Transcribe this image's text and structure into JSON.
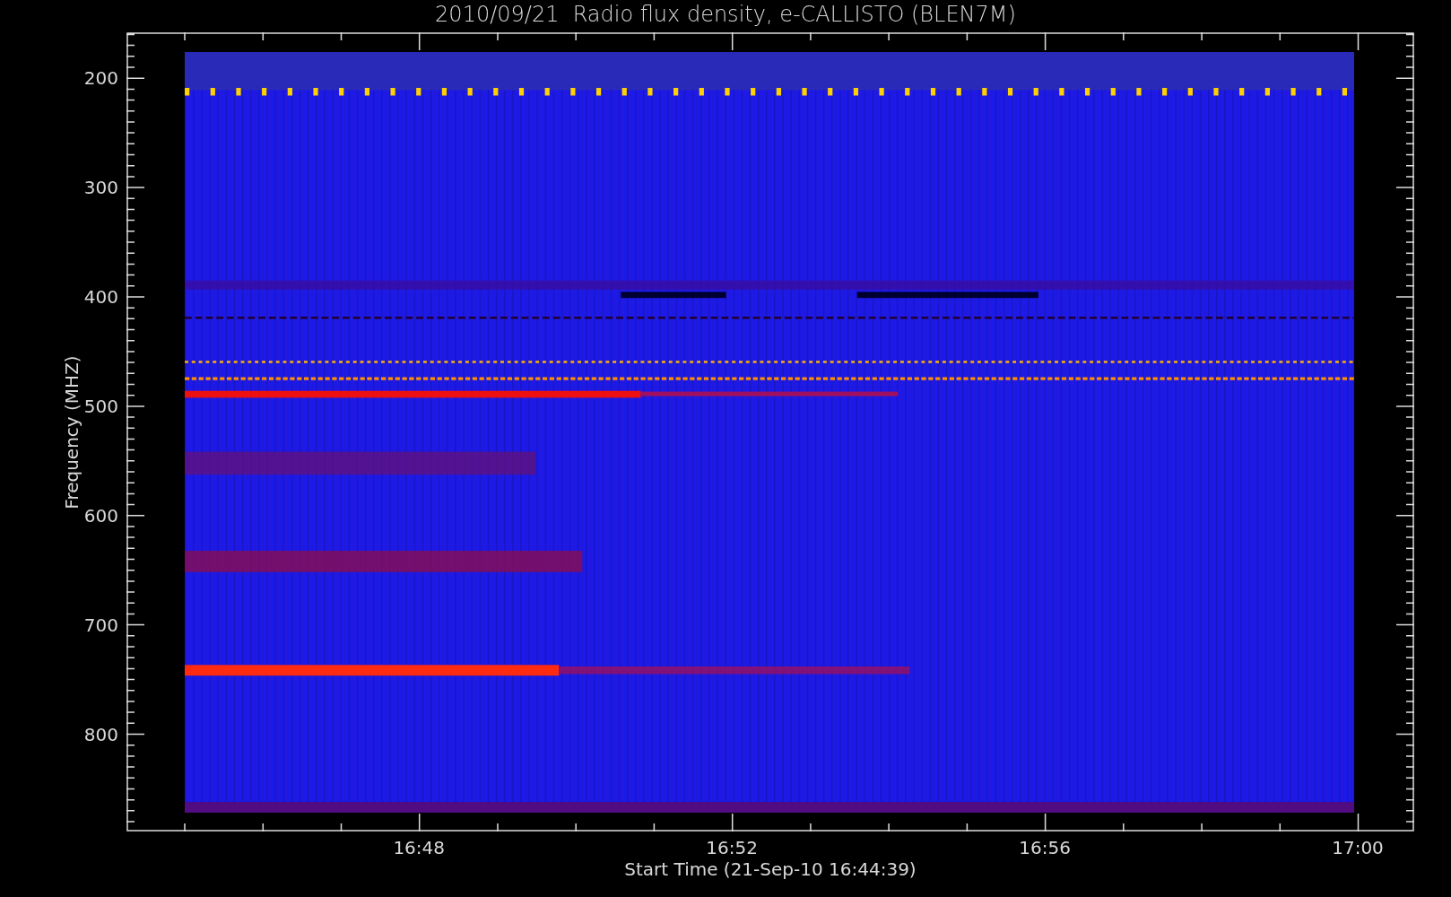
{
  "title": "2010/09/21  Radio flux density, e-CALLISTO (BLEN7M)",
  "y_axis": {
    "label": "Frequency (MHZ)",
    "ticks": [
      "200",
      "300",
      "400",
      "500",
      "600",
      "700",
      "800"
    ]
  },
  "x_axis": {
    "label": "Start Time (21-Sep-10 16:44:39)",
    "ticks": [
      "16:48",
      "16:52",
      "16:56",
      "17:00"
    ]
  }
}
